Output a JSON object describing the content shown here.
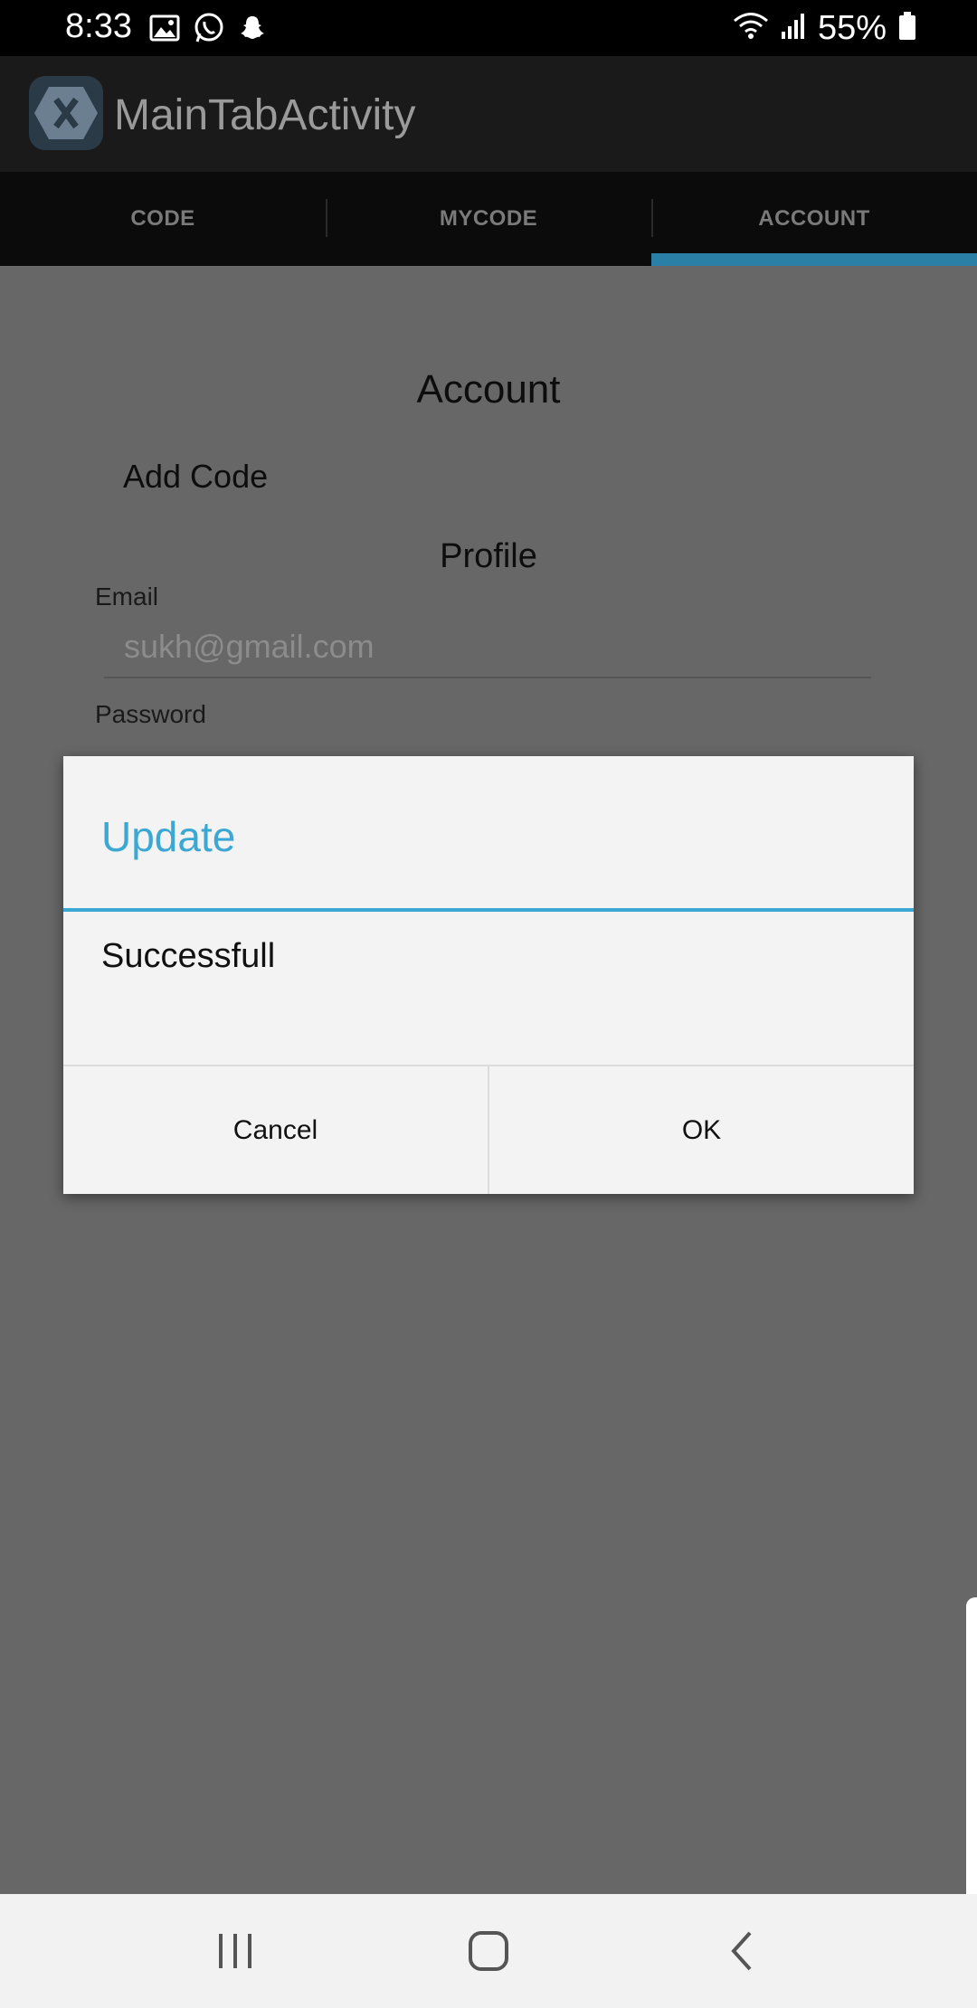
{
  "status_bar": {
    "time": "8:33",
    "battery": "55%",
    "icons_left": [
      "gallery-icon",
      "whatsapp-icon",
      "snapchat-icon"
    ],
    "icons_right": [
      "wifi-icon",
      "signal-icon",
      "battery-icon"
    ]
  },
  "app_bar": {
    "title": "MainTabActivity",
    "logo_icon": "xamarin-logo-icon"
  },
  "tabs": [
    {
      "label": "CODE",
      "active": false
    },
    {
      "label": "MYCODE",
      "active": false
    },
    {
      "label": "ACCOUNT",
      "active": true
    }
  ],
  "account": {
    "title": "Account",
    "add_code": "Add Code",
    "profile_title": "Profile",
    "email_label": "Email",
    "email_value": "sukh@gmail.com",
    "password_label": "Password"
  },
  "dialog": {
    "title": "Update",
    "message": "Successfull",
    "cancel_label": "Cancel",
    "ok_label": "OK"
  },
  "colors": {
    "accent": "#3ba8d4",
    "tab_indicator": "#2a7fa6",
    "overlay_background": "#676767"
  },
  "nav_bar": {
    "icons": [
      "recent-apps-icon",
      "home-icon",
      "back-icon"
    ]
  }
}
